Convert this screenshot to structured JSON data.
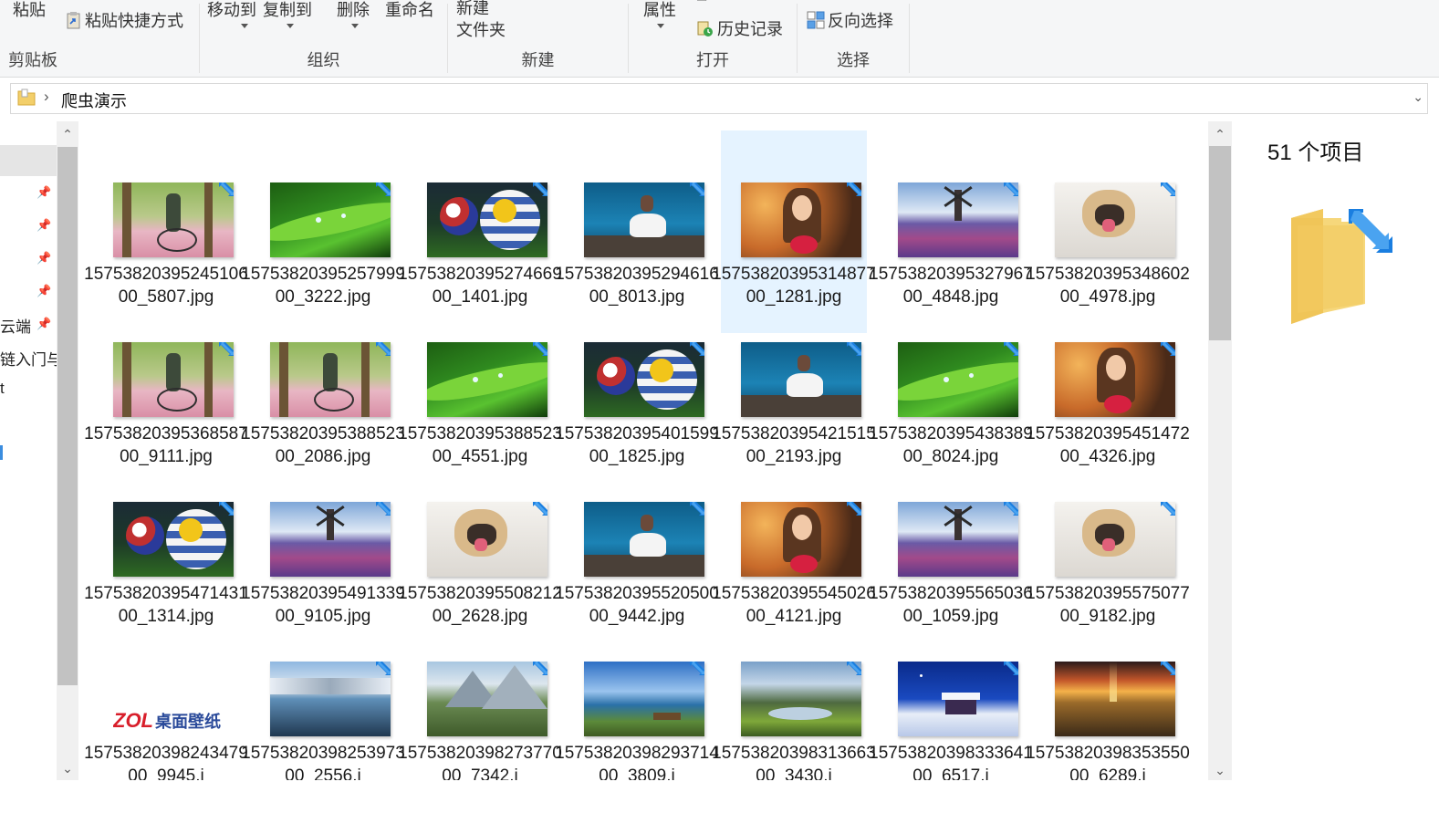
{
  "ribbon": {
    "clipboard": {
      "paste": "粘贴",
      "paste_shortcut": "粘贴快捷方式",
      "label": "剪贴板"
    },
    "organize": {
      "move_to": "移动到",
      "copy_to": "复制到",
      "delete": "删除",
      "rename": "重命名",
      "label": "组织"
    },
    "new": {
      "new_folder_line1": "新建",
      "new_folder_line2": "文件夹",
      "label": "新建"
    },
    "open": {
      "properties": "属性",
      "history": "历史记录",
      "label": "打开"
    },
    "select": {
      "invert": "反向选择",
      "label": "选择"
    }
  },
  "address": {
    "crumb": "爬虫演示"
  },
  "nav": {
    "items": [
      "云端",
      "链入门与",
      "t"
    ]
  },
  "preview": {
    "count": "51 个项目"
  },
  "colors": {
    "selection": "#e5f3ff",
    "shortcut_arrow": "#1a7ee0",
    "folder": "#f3cf6a"
  },
  "files": [
    {
      "l1": "1575382039524510600_5807.j",
      "l2": "pg",
      "thumb": "forest-bike"
    },
    {
      "l1": "1575382039525799900_3222.j",
      "l2": "pg",
      "thumb": "leaf"
    },
    {
      "l1": "1575382039527466900_1401.j",
      "l2": "pg",
      "thumb": "balls"
    },
    {
      "l1": "1575382039529461600_8013.j",
      "l2": "pg",
      "thumb": "lake-girl"
    },
    {
      "l1": "1575382039531487700_1281.j",
      "l2": "pg",
      "thumb": "portrait"
    },
    {
      "l1": "1575382039532796700_4848.j",
      "l2": "pg",
      "thumb": "windmill"
    },
    {
      "l1": "1575382039534860200_4978.j",
      "l2": "pg",
      "thumb": "pug"
    },
    {
      "l1": "1575382039536858700_9111.j",
      "l2": "pg",
      "thumb": "forest-bike"
    },
    {
      "l1": "1575382039538852300_2086.j",
      "l2": "pg",
      "thumb": "forest-bike"
    },
    {
      "l1": "1575382039538852300_4551.j",
      "l2": "pg",
      "thumb": "leaf"
    },
    {
      "l1": "1575382039540159900_1825.j",
      "l2": "pg",
      "thumb": "balls"
    },
    {
      "l1": "1575382039542151500_2193.j",
      "l2": "pg",
      "thumb": "lake-girl"
    },
    {
      "l1": "1575382039543838900_8024.j",
      "l2": "pg",
      "thumb": "leaf"
    },
    {
      "l1": "1575382039545147200_4326.j",
      "l2": "pg",
      "thumb": "portrait"
    },
    {
      "l1": "1575382039547143100_1314.j",
      "l2": "pg",
      "thumb": "balls"
    },
    {
      "l1": "1575382039549133900_9105.j",
      "l2": "pg",
      "thumb": "windmill"
    },
    {
      "l1": "1575382039550821200_2628.j",
      "l2": "pg",
      "thumb": "pug"
    },
    {
      "l1": "1575382039552050000_9442.j",
      "l2": "pg",
      "thumb": "lake-girl"
    },
    {
      "l1": "1575382039554502600_4121.j",
      "l2": "pg",
      "thumb": "portrait"
    },
    {
      "l1": "1575382039556503600_1059.j",
      "l2": "pg",
      "thumb": "windmill"
    },
    {
      "l1": "1575382039557507700_9182.j",
      "l2": "pg",
      "thumb": "pug"
    },
    {
      "l1": "1575382039824347900_9945.j",
      "l2": "",
      "thumb": "zol",
      "logo": "ZOL",
      "logo_text": "桌面壁纸"
    },
    {
      "l1": "1575382039825397300_2556.j",
      "l2": "",
      "thumb": "ice-lake"
    },
    {
      "l1": "1575382039827377000_7342.j",
      "l2": "",
      "thumb": "alps"
    },
    {
      "l1": "1575382039829371400_3809.j",
      "l2": "",
      "thumb": "bench-lake"
    },
    {
      "l1": "1575382039831366300_3430.j",
      "l2": "",
      "thumb": "valley"
    },
    {
      "l1": "1575382039833364100_6517.j",
      "l2": "",
      "thumb": "snow-house"
    },
    {
      "l1": "1575382039835355000_6289.j",
      "l2": "",
      "thumb": "sunset-vineyard"
    }
  ]
}
